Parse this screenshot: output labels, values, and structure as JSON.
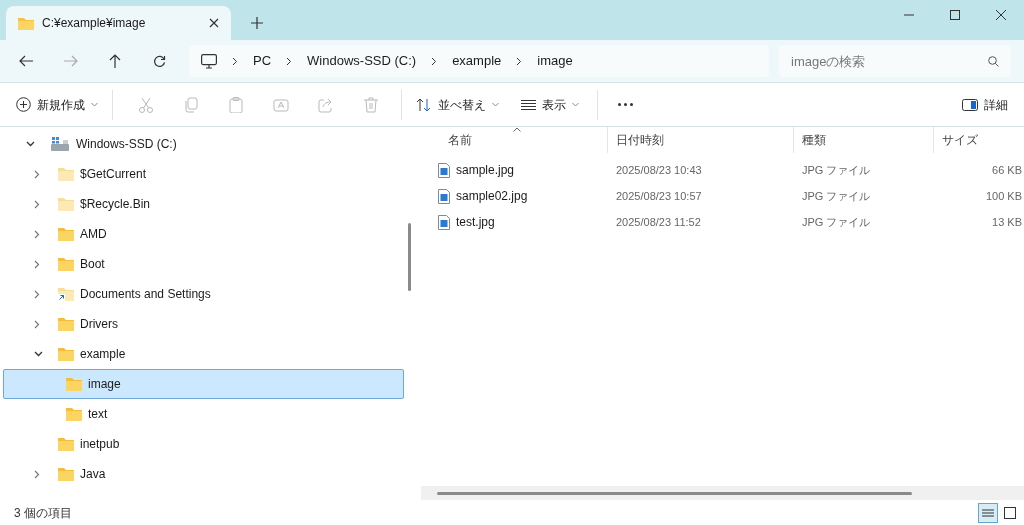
{
  "tab": {
    "title": "C:¥example¥image"
  },
  "breadcrumb": [
    "PC",
    "Windows-SSD (C:)",
    "example",
    "image"
  ],
  "search": {
    "placeholder": "imageの検索"
  },
  "toolbar": {
    "new_label": "新規作成",
    "actions": [
      {
        "kind": "cut",
        "disabled": true
      },
      {
        "kind": "copy",
        "disabled": true
      },
      {
        "kind": "paste",
        "disabled": true
      },
      {
        "kind": "rename",
        "disabled": true
      },
      {
        "kind": "share",
        "disabled": true
      },
      {
        "kind": "delete",
        "disabled": true
      }
    ],
    "sort_label": "並べ替え",
    "view_label": "表示",
    "details_label": "詳細"
  },
  "tree": [
    {
      "label": "Windows-SSD (C:)",
      "kind": "drive",
      "expanded": true,
      "selected": false,
      "children": [
        {
          "label": "$GetCurrent",
          "kind": "hidden-folder",
          "expanded": false,
          "selected": false
        },
        {
          "label": "$Recycle.Bin",
          "kind": "hidden-folder",
          "expanded": false,
          "selected": false
        },
        {
          "label": "AMD",
          "kind": "folder",
          "expanded": false,
          "selected": false
        },
        {
          "label": "Boot",
          "kind": "folder",
          "expanded": false,
          "selected": false
        },
        {
          "label": "Documents and Settings",
          "kind": "shortcut-folder",
          "expanded": false,
          "selected": false
        },
        {
          "label": "Drivers",
          "kind": "folder",
          "expanded": false,
          "selected": false
        },
        {
          "label": "example",
          "kind": "folder",
          "expanded": true,
          "selected": false,
          "children": [
            {
              "label": "image",
              "kind": "folder",
              "selected": true
            },
            {
              "label": "text",
              "kind": "folder",
              "selected": false
            }
          ]
        },
        {
          "label": "inetpub",
          "kind": "folder",
          "selected": false
        },
        {
          "label": "Java",
          "kind": "folder",
          "expanded": false,
          "selected": false
        }
      ]
    }
  ],
  "table": {
    "columns": [
      {
        "label": "名前",
        "sorted": true
      },
      {
        "label": "日付時刻",
        "sorted": false
      },
      {
        "label": "種類",
        "sorted": false
      },
      {
        "label": "サイズ",
        "sorted": false
      }
    ],
    "rows": [
      {
        "name": "sample.jpg",
        "date": "2025/08/23 10:43",
        "type": "JPG ファイル",
        "size": "66 KB"
      },
      {
        "name": "sample02.jpg",
        "date": "2025/08/23 10:57",
        "type": "JPG ファイル",
        "size": "100 KB"
      },
      {
        "name": "test.jpg",
        "date": "2025/08/23 11:52",
        "type": "JPG ファイル",
        "size": "13 KB"
      }
    ]
  },
  "status_bar": {
    "count": "3 個の項目",
    "views": [
      {
        "kind": "details",
        "selected": true
      },
      {
        "kind": "tiles",
        "selected": false
      }
    ]
  }
}
